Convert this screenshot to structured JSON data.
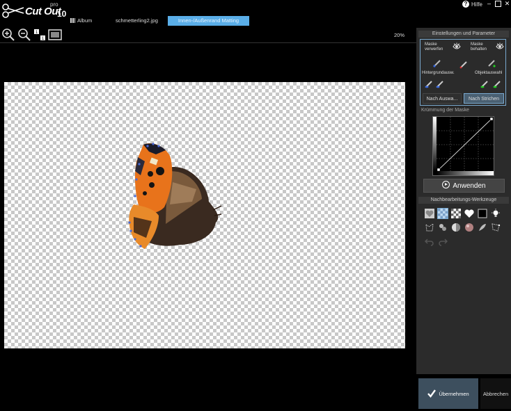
{
  "app": {
    "logo_text": "Cut Out",
    "logo_pro": "pro",
    "logo_version": "10"
  },
  "tabs": [
    {
      "label": "Album"
    },
    {
      "label": "schmetterling2.jpg"
    },
    {
      "label": "Innen-/Außenrand Matting",
      "active": true
    }
  ],
  "header": {
    "help_label": "Hilfe"
  },
  "toolbar": {
    "zoom_percent": "20%"
  },
  "panel": {
    "settings_title": "Einstellungen und Parameter",
    "mask_discard": "Maske verwerfen",
    "mask_keep": "Maske behalten",
    "background_select": "Hintergrundausw.",
    "object_select": "Objektauswahl",
    "by_selection": "Nach Auswa...",
    "by_strokes": "Nach Strichen",
    "curve_label": "Krümmung der Maske",
    "apply": "Anwenden",
    "postproc_title": "Nachbearbeitungs-Werkzeuge"
  },
  "footer": {
    "accept": "Übernehmen",
    "cancel": "Abbrechen"
  },
  "colors": {
    "accent": "#5aaee8",
    "panel": "#2b2b2b",
    "active_mode": "#4a6072"
  }
}
